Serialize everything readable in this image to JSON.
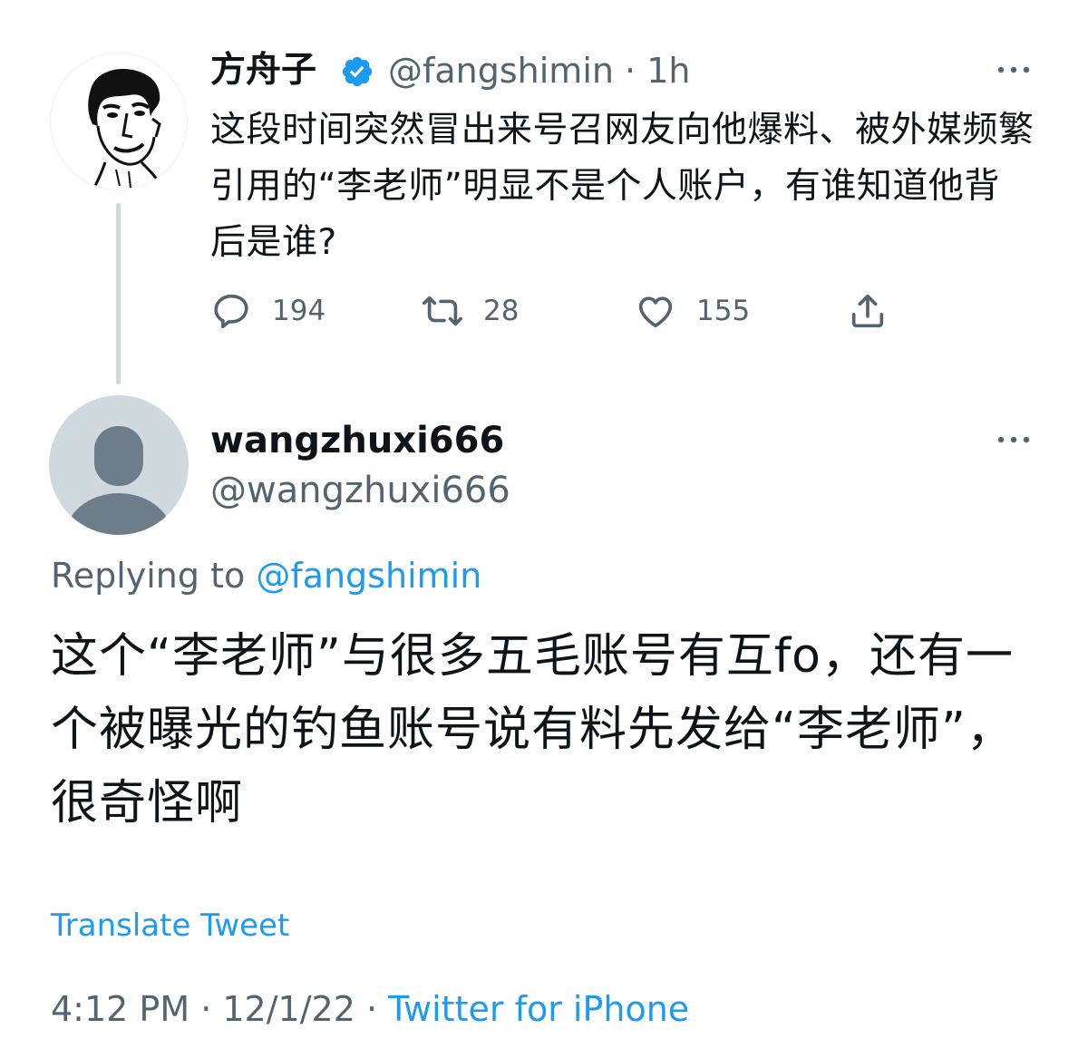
{
  "tweet": {
    "author_name": "方舟子",
    "author_handle": "@fangshimin",
    "time_ago": "1h",
    "separator": " · ",
    "text": "这段时间突然冒出来号召网友向他爆料、被外媒频繁引用的“李老师”明显不是个人账户，有谁知道他背后是谁?",
    "verified": true,
    "actions": {
      "replies": "194",
      "retweets": "28",
      "likes": "155"
    }
  },
  "reply": {
    "author_name": "wangzhuxi666",
    "author_handle": "@wangzhuxi666",
    "replying_to_prefix": "Replying to ",
    "replying_to_handle": "@fangshimin",
    "text": "这个“李老师”与很多五毛账号有互fo，还有一个被曝光的钓鱼账号说有料先发给“李老师”，很奇怪啊",
    "translate_label": "Translate Tweet",
    "time": "4:12 PM",
    "date": "12/1/22",
    "source": "Twitter for iPhone"
  },
  "colors": {
    "accent": "#1d9bf0",
    "secondary_text": "#536471",
    "primary_text": "#0f1419",
    "thread_line": "#cfd9de"
  },
  "icons": [
    "verified-badge-icon",
    "more-icon",
    "reply-icon",
    "retweet-icon",
    "like-icon",
    "share-icon",
    "default-avatar-icon"
  ]
}
